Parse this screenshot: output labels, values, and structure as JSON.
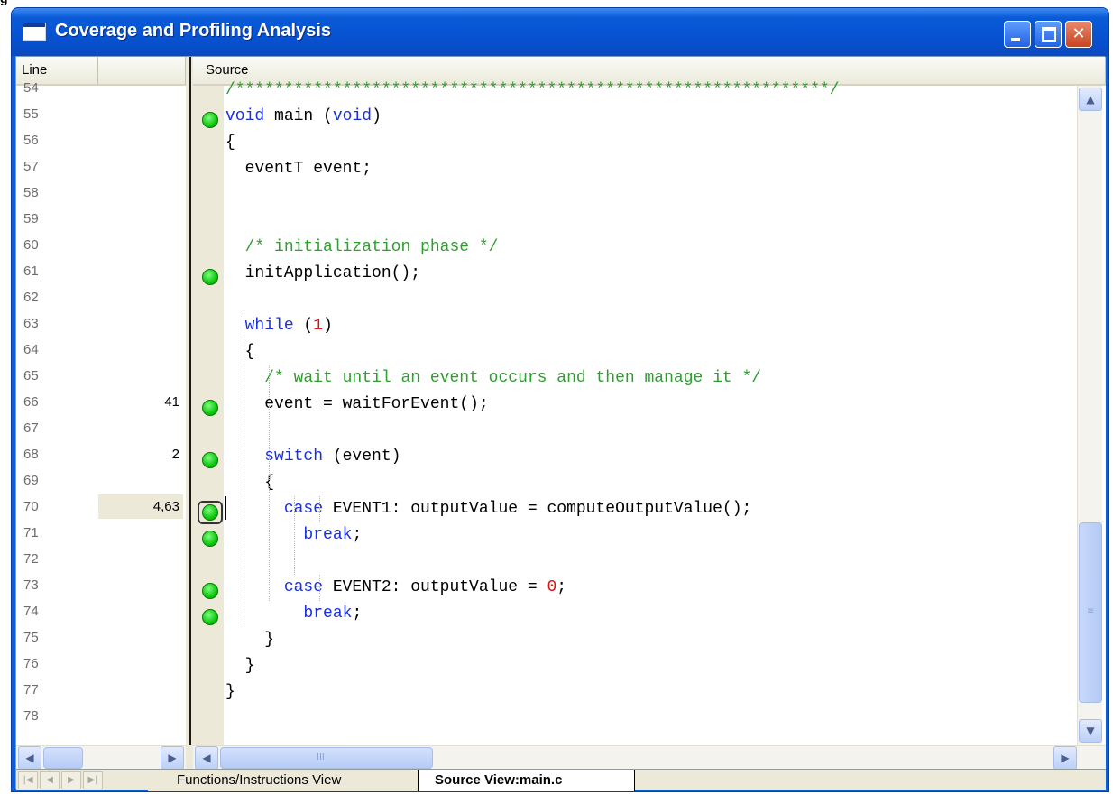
{
  "window": {
    "title": "Coverage and Profiling Analysis",
    "minimize_glyph": "_",
    "close_glyph": "✕"
  },
  "left_pane": {
    "headers": [
      "Line",
      ""
    ],
    "lines": [
      "54",
      "55",
      "56",
      "57",
      "58",
      "59",
      "60",
      "61",
      "62",
      "63",
      "64",
      "65",
      "66",
      "67",
      "68",
      "69",
      "70",
      "71",
      "72",
      "73",
      "74",
      "75",
      "76",
      "77",
      "78"
    ],
    "counts": [
      {
        "line": "66",
        "value": "41"
      },
      {
        "line": "68",
        "value": "2"
      },
      {
        "line": "70",
        "value": "4,63"
      }
    ]
  },
  "source_pane": {
    "header": "Source",
    "code_lines": [
      {
        "line": "54",
        "covered": false,
        "tokens": [
          {
            "t": "/*************************************************************/",
            "c": "cm"
          }
        ]
      },
      {
        "line": "55",
        "covered": true,
        "tokens": [
          {
            "t": "void",
            "c": "kw"
          },
          {
            "t": " main (",
            "c": ""
          },
          {
            "t": "void",
            "c": "kw"
          },
          {
            "t": ")",
            "c": ""
          }
        ]
      },
      {
        "line": "56",
        "covered": false,
        "tokens": [
          {
            "t": "{",
            "c": ""
          }
        ]
      },
      {
        "line": "57",
        "covered": false,
        "tokens": [
          {
            "t": "  eventT event;",
            "c": ""
          }
        ]
      },
      {
        "line": "58",
        "covered": false,
        "tokens": []
      },
      {
        "line": "59",
        "covered": false,
        "tokens": []
      },
      {
        "line": "60",
        "covered": false,
        "tokens": [
          {
            "t": "  ",
            "c": ""
          },
          {
            "t": "/* initialization phase */",
            "c": "cm"
          }
        ]
      },
      {
        "line": "61",
        "covered": true,
        "tokens": [
          {
            "t": "  initApplication();",
            "c": ""
          }
        ]
      },
      {
        "line": "62",
        "covered": false,
        "tokens": []
      },
      {
        "line": "63",
        "covered": false,
        "tokens": [
          {
            "t": "  ",
            "c": ""
          },
          {
            "t": "while",
            "c": "kw"
          },
          {
            "t": " (",
            "c": ""
          },
          {
            "t": "1",
            "c": "num"
          },
          {
            "t": ")",
            "c": ""
          }
        ]
      },
      {
        "line": "64",
        "covered": false,
        "tokens": [
          {
            "t": "  {",
            "c": ""
          }
        ]
      },
      {
        "line": "65",
        "covered": false,
        "tokens": [
          {
            "t": "    ",
            "c": ""
          },
          {
            "t": "/* wait until an event occurs and then manage it */",
            "c": "cm"
          }
        ]
      },
      {
        "line": "66",
        "covered": true,
        "tokens": [
          {
            "t": "    event = waitForEvent();",
            "c": ""
          }
        ]
      },
      {
        "line": "67",
        "covered": false,
        "tokens": []
      },
      {
        "line": "68",
        "covered": true,
        "tokens": [
          {
            "t": "    ",
            "c": ""
          },
          {
            "t": "switch",
            "c": "kw"
          },
          {
            "t": " (event)",
            "c": ""
          }
        ]
      },
      {
        "line": "69",
        "covered": false,
        "tokens": [
          {
            "t": "    {",
            "c": ""
          }
        ]
      },
      {
        "line": "70",
        "covered": true,
        "selected": true,
        "tokens": [
          {
            "t": "      ",
            "c": ""
          },
          {
            "t": "case",
            "c": "kw"
          },
          {
            "t": " EVENT1: outputValue = computeOutputValue();",
            "c": ""
          }
        ]
      },
      {
        "line": "71",
        "covered": true,
        "tokens": [
          {
            "t": "        ",
            "c": ""
          },
          {
            "t": "break",
            "c": "kw"
          },
          {
            "t": ";",
            "c": ""
          }
        ]
      },
      {
        "line": "72",
        "covered": false,
        "tokens": []
      },
      {
        "line": "73",
        "covered": true,
        "tokens": [
          {
            "t": "      ",
            "c": ""
          },
          {
            "t": "case",
            "c": "kw"
          },
          {
            "t": " EVENT2: outputValue = ",
            "c": ""
          },
          {
            "t": "0",
            "c": "num"
          },
          {
            "t": ";",
            "c": ""
          }
        ]
      },
      {
        "line": "74",
        "covered": true,
        "tokens": [
          {
            "t": "        ",
            "c": ""
          },
          {
            "t": "break",
            "c": "kw"
          },
          {
            "t": ";",
            "c": ""
          }
        ]
      },
      {
        "line": "75",
        "covered": false,
        "tokens": [
          {
            "t": "    }",
            "c": ""
          }
        ]
      },
      {
        "line": "76",
        "covered": false,
        "tokens": [
          {
            "t": "  }",
            "c": ""
          }
        ]
      },
      {
        "line": "77",
        "covered": false,
        "tokens": [
          {
            "t": "}",
            "c": ""
          }
        ]
      },
      {
        "line": "78",
        "covered": false,
        "tokens": []
      }
    ]
  },
  "scroll": {
    "up": "▲",
    "down": "▼",
    "left": "◀",
    "right": "▶",
    "grip_v": "≡",
    "grip_h": "III"
  },
  "tabs": {
    "nav": [
      "|◀",
      "◀",
      "▶",
      "▶|"
    ],
    "items": [
      {
        "label": "Functions/Instructions View",
        "active": false
      },
      {
        "label": "Source View:main.c",
        "active": true
      }
    ]
  },
  "colors": {
    "titlebar": "#0653d2",
    "keyword": "#1a2fe0",
    "comment": "#2e9e2e",
    "number": "#e01010",
    "coverage_dot": "#0fc70f"
  }
}
